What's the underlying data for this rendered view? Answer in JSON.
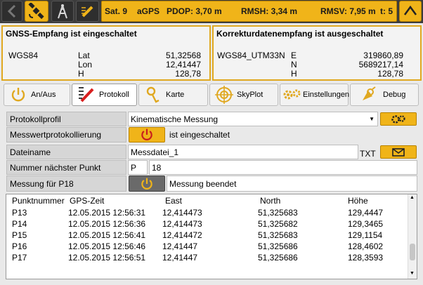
{
  "status": {
    "sat": "Sat. 9",
    "mode": "aGPS",
    "pdop": "PDOP: 3,70  m",
    "rmsh": "RMSH: 3,34  m",
    "rmsv": "RMSV: 7,95  m",
    "t": "t: 5"
  },
  "gnss": {
    "title": "GNSS-Empfang ist eingeschaltet",
    "datum": "WGS84",
    "rows": [
      {
        "label": "Lat",
        "value": "51,32568"
      },
      {
        "label": "Lon",
        "value": "12,41447"
      },
      {
        "label": "H",
        "value": "128,78"
      }
    ]
  },
  "correction": {
    "title": "Korrekturdatenempfang ist ausgeschaltet",
    "datum": "WGS84_UTM33N",
    "rows": [
      {
        "label": "E",
        "value": "319860,89"
      },
      {
        "label": "N",
        "value": "5689217,14"
      },
      {
        "label": "H",
        "value": "128,78"
      }
    ]
  },
  "tabs": [
    {
      "label": "An/Aus",
      "icon": "power-icon"
    },
    {
      "label": "Protokoll",
      "icon": "protocol-icon"
    },
    {
      "label": "Karte",
      "icon": "map-pin-icon"
    },
    {
      "label": "SkyPlot",
      "icon": "crosshair-icon"
    },
    {
      "label": "Einstellungen",
      "icon": "gears-icon"
    },
    {
      "label": "Debug",
      "icon": "bug-icon"
    }
  ],
  "active_tab": "Protokoll",
  "form": {
    "profile_label": "Protokollprofil",
    "profile_value": "Kinematische Messung",
    "logging_label": "Messwertprotokollierung",
    "logging_status": "ist eingeschaltet",
    "filename_label": "Dateiname",
    "filename_value": "Messdatei_1",
    "filename_ext": "TXT",
    "nextpoint_label": "Nummer nächster Punkt",
    "nextpoint_prefix": "P",
    "nextpoint_value": "18",
    "measure_label": "Messung für  P18",
    "measure_status": "Messung beendet"
  },
  "table": {
    "columns": [
      "Punktnummer",
      "GPS-Zeit",
      "East",
      "North",
      "Höhe"
    ],
    "rows": [
      [
        "P13",
        "12.05.2015 12:56:31",
        "12,414473",
        "51,325683",
        "129,4447"
      ],
      [
        "P14",
        "12.05.2015 12:56:36",
        "12,414473",
        "51,325682",
        "129,3465"
      ],
      [
        "P15",
        "12.05.2015 12:56:41",
        "12,414472",
        "51,325683",
        "129,1154"
      ],
      [
        "P16",
        "12.05.2015 12:56:46",
        "12,41447",
        "51,325686",
        "128,4602"
      ],
      [
        "P17",
        "12.05.2015 12:56:51",
        "12,41447",
        "51,325686",
        "128,3593"
      ]
    ]
  },
  "colors": {
    "accent": "#f0b419",
    "topbar": "#3c3c3c",
    "protocol_red": "#d81e1e"
  }
}
